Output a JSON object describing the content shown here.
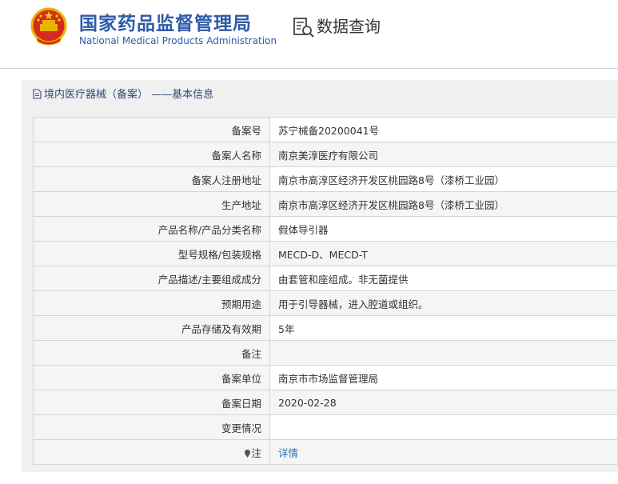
{
  "header": {
    "agency_cn": "国家药品监督管理局",
    "agency_en": "National Medical Products Administration",
    "query_label": "数据查询",
    "emblem_icon": "national-emblem-icon",
    "query_icon": "document-search-icon"
  },
  "panel": {
    "title": "境内医疗器械（备案） ——基本信息",
    "title_icon": "document-icon"
  },
  "rows": [
    {
      "label": "备案号",
      "value": "苏宁械备20200041号"
    },
    {
      "label": "备案人名称",
      "value": "南京美淳医疗有限公司"
    },
    {
      "label": "备案人注册地址",
      "value": "南京市高淳区经济开发区桃园路8号（漆桥工业园）"
    },
    {
      "label": "生产地址",
      "value": "南京市高淳区经济开发区桃园路8号（漆桥工业园）"
    },
    {
      "label": "产品名称/产品分类名称",
      "value": "假体导引器"
    },
    {
      "label": "型号规格/包装规格",
      "value": "MECD-D、MECD-T"
    },
    {
      "label": "产品描述/主要组成成分",
      "value": "由套管和座组成。非无菌提供"
    },
    {
      "label": "预期用途",
      "value": "用于引导器械，进入腔道或组织。"
    },
    {
      "label": "产品存储及有效期",
      "value": "5年"
    },
    {
      "label": "备注",
      "value": ""
    },
    {
      "label": "备案单位",
      "value": "南京市市场监督管理局"
    },
    {
      "label": "备案日期",
      "value": "2020-02-28"
    },
    {
      "label": "变更情况",
      "value": ""
    }
  ],
  "note": {
    "label": "注",
    "link": "详情",
    "icon": "pin-icon"
  },
  "colors": {
    "brand_blue": "#2f5aa8",
    "link_blue": "#2f6fb6"
  }
}
